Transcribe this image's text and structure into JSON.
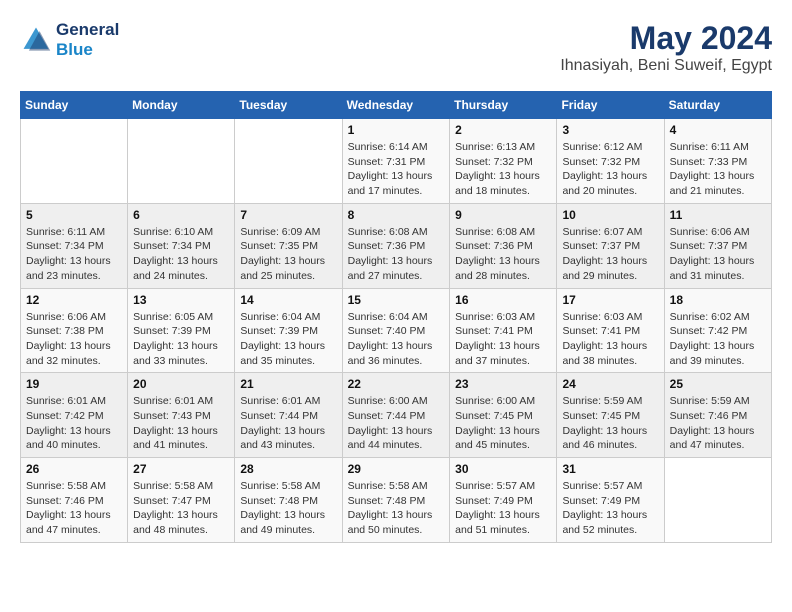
{
  "logo": {
    "line1": "General",
    "line2": "Blue"
  },
  "title": "May 2024",
  "subtitle": "Ihnasiyah, Beni Suweif, Egypt",
  "weekdays": [
    "Sunday",
    "Monday",
    "Tuesday",
    "Wednesday",
    "Thursday",
    "Friday",
    "Saturday"
  ],
  "weeks": [
    [
      {
        "day": "",
        "info": ""
      },
      {
        "day": "",
        "info": ""
      },
      {
        "day": "",
        "info": ""
      },
      {
        "day": "1",
        "info": "Sunrise: 6:14 AM\nSunset: 7:31 PM\nDaylight: 13 hours\nand 17 minutes."
      },
      {
        "day": "2",
        "info": "Sunrise: 6:13 AM\nSunset: 7:32 PM\nDaylight: 13 hours\nand 18 minutes."
      },
      {
        "day": "3",
        "info": "Sunrise: 6:12 AM\nSunset: 7:32 PM\nDaylight: 13 hours\nand 20 minutes."
      },
      {
        "day": "4",
        "info": "Sunrise: 6:11 AM\nSunset: 7:33 PM\nDaylight: 13 hours\nand 21 minutes."
      }
    ],
    [
      {
        "day": "5",
        "info": "Sunrise: 6:11 AM\nSunset: 7:34 PM\nDaylight: 13 hours\nand 23 minutes."
      },
      {
        "day": "6",
        "info": "Sunrise: 6:10 AM\nSunset: 7:34 PM\nDaylight: 13 hours\nand 24 minutes."
      },
      {
        "day": "7",
        "info": "Sunrise: 6:09 AM\nSunset: 7:35 PM\nDaylight: 13 hours\nand 25 minutes."
      },
      {
        "day": "8",
        "info": "Sunrise: 6:08 AM\nSunset: 7:36 PM\nDaylight: 13 hours\nand 27 minutes."
      },
      {
        "day": "9",
        "info": "Sunrise: 6:08 AM\nSunset: 7:36 PM\nDaylight: 13 hours\nand 28 minutes."
      },
      {
        "day": "10",
        "info": "Sunrise: 6:07 AM\nSunset: 7:37 PM\nDaylight: 13 hours\nand 29 minutes."
      },
      {
        "day": "11",
        "info": "Sunrise: 6:06 AM\nSunset: 7:37 PM\nDaylight: 13 hours\nand 31 minutes."
      }
    ],
    [
      {
        "day": "12",
        "info": "Sunrise: 6:06 AM\nSunset: 7:38 PM\nDaylight: 13 hours\nand 32 minutes."
      },
      {
        "day": "13",
        "info": "Sunrise: 6:05 AM\nSunset: 7:39 PM\nDaylight: 13 hours\nand 33 minutes."
      },
      {
        "day": "14",
        "info": "Sunrise: 6:04 AM\nSunset: 7:39 PM\nDaylight: 13 hours\nand 35 minutes."
      },
      {
        "day": "15",
        "info": "Sunrise: 6:04 AM\nSunset: 7:40 PM\nDaylight: 13 hours\nand 36 minutes."
      },
      {
        "day": "16",
        "info": "Sunrise: 6:03 AM\nSunset: 7:41 PM\nDaylight: 13 hours\nand 37 minutes."
      },
      {
        "day": "17",
        "info": "Sunrise: 6:03 AM\nSunset: 7:41 PM\nDaylight: 13 hours\nand 38 minutes."
      },
      {
        "day": "18",
        "info": "Sunrise: 6:02 AM\nSunset: 7:42 PM\nDaylight: 13 hours\nand 39 minutes."
      }
    ],
    [
      {
        "day": "19",
        "info": "Sunrise: 6:01 AM\nSunset: 7:42 PM\nDaylight: 13 hours\nand 40 minutes."
      },
      {
        "day": "20",
        "info": "Sunrise: 6:01 AM\nSunset: 7:43 PM\nDaylight: 13 hours\nand 41 minutes."
      },
      {
        "day": "21",
        "info": "Sunrise: 6:01 AM\nSunset: 7:44 PM\nDaylight: 13 hours\nand 43 minutes."
      },
      {
        "day": "22",
        "info": "Sunrise: 6:00 AM\nSunset: 7:44 PM\nDaylight: 13 hours\nand 44 minutes."
      },
      {
        "day": "23",
        "info": "Sunrise: 6:00 AM\nSunset: 7:45 PM\nDaylight: 13 hours\nand 45 minutes."
      },
      {
        "day": "24",
        "info": "Sunrise: 5:59 AM\nSunset: 7:45 PM\nDaylight: 13 hours\nand 46 minutes."
      },
      {
        "day": "25",
        "info": "Sunrise: 5:59 AM\nSunset: 7:46 PM\nDaylight: 13 hours\nand 47 minutes."
      }
    ],
    [
      {
        "day": "26",
        "info": "Sunrise: 5:58 AM\nSunset: 7:46 PM\nDaylight: 13 hours\nand 47 minutes."
      },
      {
        "day": "27",
        "info": "Sunrise: 5:58 AM\nSunset: 7:47 PM\nDaylight: 13 hours\nand 48 minutes."
      },
      {
        "day": "28",
        "info": "Sunrise: 5:58 AM\nSunset: 7:48 PM\nDaylight: 13 hours\nand 49 minutes."
      },
      {
        "day": "29",
        "info": "Sunrise: 5:58 AM\nSunset: 7:48 PM\nDaylight: 13 hours\nand 50 minutes."
      },
      {
        "day": "30",
        "info": "Sunrise: 5:57 AM\nSunset: 7:49 PM\nDaylight: 13 hours\nand 51 minutes."
      },
      {
        "day": "31",
        "info": "Sunrise: 5:57 AM\nSunset: 7:49 PM\nDaylight: 13 hours\nand 52 minutes."
      },
      {
        "day": "",
        "info": ""
      }
    ]
  ]
}
